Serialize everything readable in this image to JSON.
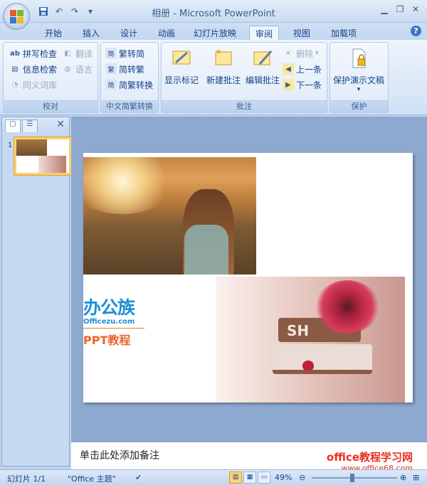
{
  "window": {
    "title": "相册 - Microsoft PowerPoint"
  },
  "qat": {
    "save_icon": "save-icon",
    "undo_icon": "undo-icon",
    "redo_icon": "redo-icon",
    "customize_icon": "customize-qat-icon"
  },
  "tabs": [
    {
      "label": "开始"
    },
    {
      "label": "插入"
    },
    {
      "label": "设计"
    },
    {
      "label": "动画"
    },
    {
      "label": "幻灯片放映"
    },
    {
      "label": "审阅"
    },
    {
      "label": "视图"
    },
    {
      "label": "加载项"
    }
  ],
  "ribbon": {
    "proofing": {
      "label": "校对",
      "spell": "拼写检查",
      "research": "信息检索",
      "thesaurus": "同义词库",
      "translate": "翻译",
      "language": "语言"
    },
    "chinese": {
      "label": "中文简繁转换",
      "t2s": "繁转简",
      "s2t": "简转繁",
      "convert": "简繁转换"
    },
    "comments": {
      "label": "批注",
      "show_markup": "显示标记",
      "new_comment": "新建批注",
      "edit_comment": "编辑批注",
      "delete": "删除",
      "previous": "上一条",
      "next": "下一条"
    },
    "protect": {
      "label": "保护",
      "protect_presentation": "保护演示文稿"
    }
  },
  "thumbnails": [
    {
      "number": "1"
    }
  ],
  "slide": {
    "logo_main": "办公族",
    "logo_sub": "Officezu.com",
    "logo_tag": "PPT教程",
    "book_text": "SH"
  },
  "notes": {
    "placeholder": "单击此处添加备注"
  },
  "watermark": {
    "line1": "office教程学习网",
    "line2": "www.office68.com"
  },
  "status": {
    "slide_info": "幻灯片 1/1",
    "theme": "\"Office 主题\"",
    "zoom": "49%"
  },
  "colors": {
    "accent": "#15428b",
    "ribbon_bg": "#dae7f7",
    "watermark": "#e8301e"
  }
}
